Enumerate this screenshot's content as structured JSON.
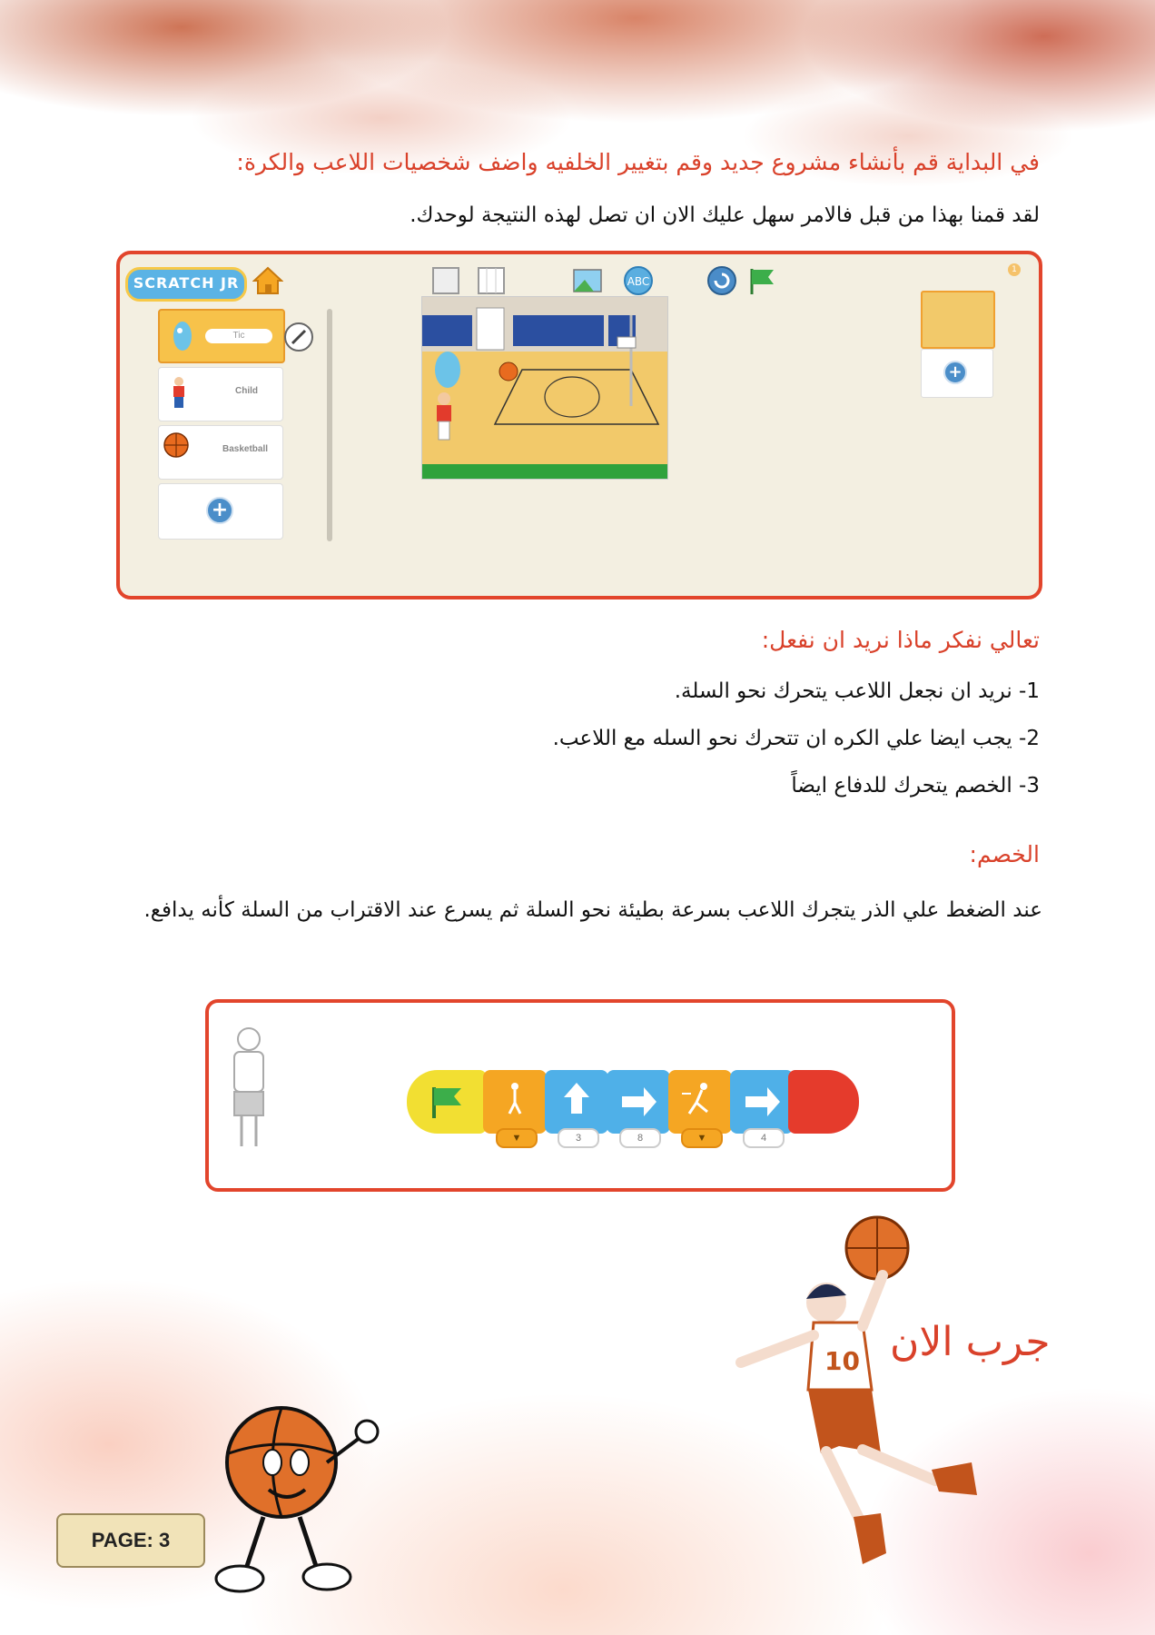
{
  "intro": {
    "heading": "في البداية قم بأنشاء مشروع جديد وقم بتغيير الخلفيه واضف شخصيات اللاعب والكرة:",
    "text": "لقد قمنا بهذا من قبل فالامر سهل عليك الان ان تصل لهذه النتيجة لوحدك."
  },
  "scratch": {
    "logo_text": "SCRATCH JR",
    "page_number": "1",
    "sprites": [
      {
        "name": "Tic"
      },
      {
        "name": "Child"
      },
      {
        "name": "Basketball"
      }
    ],
    "add_label": "+"
  },
  "plan": {
    "heading": "تعالي نفكر ماذا نريد ان نفعل:",
    "items": [
      "1- نريد ان نجعل اللاعب يتحرك نحو السلة.",
      "2- يجب ايضا علي الكره ان تتحرك نحو السله مع اللاعب.",
      "3- الخصم يتحرك للدفاع ايضاً"
    ]
  },
  "opponent": {
    "heading": "الخصم:",
    "text": "عند الضغط علي الذر يتجرك اللاعب بسرعة بطيئة نحو السلة ثم يسرع عند الاقتراب من السلة كأنه يدافع."
  },
  "code_blocks": {
    "params": [
      "3",
      "8",
      "4"
    ],
    "icons": [
      "green-flag",
      "set-speed-slow",
      "move-up",
      "move-right",
      "set-speed-fast",
      "move-right",
      "end"
    ]
  },
  "try_now": "جرب الان",
  "page_label": "PAGE: 3",
  "colors": {
    "accent_red": "#d9412a",
    "frame_red": "#e2452c"
  }
}
